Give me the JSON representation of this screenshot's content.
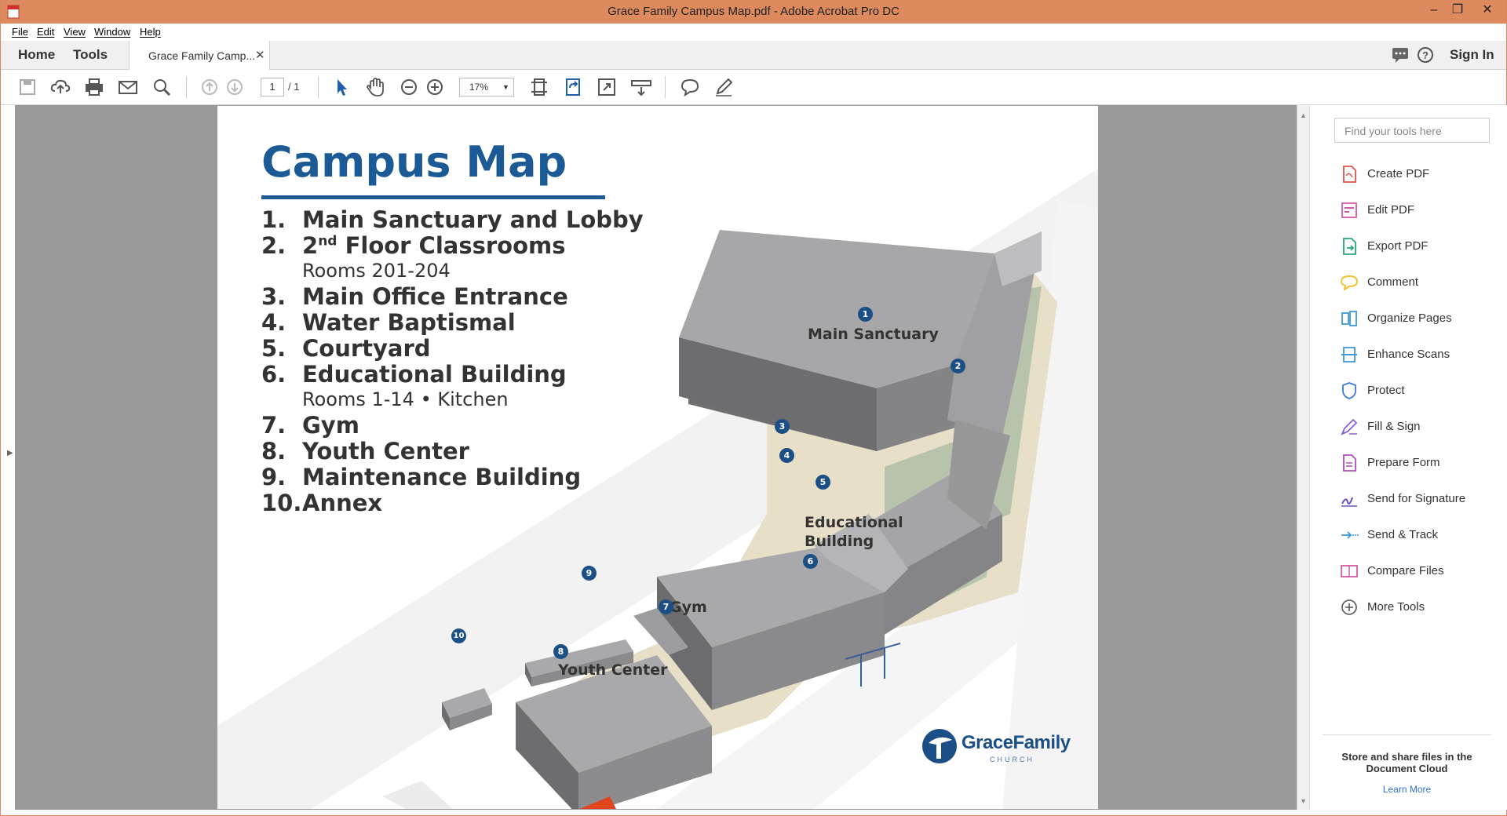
{
  "window": {
    "title": "Grace Family Campus Map.pdf - Adobe Acrobat Pro DC"
  },
  "menu": [
    "File",
    "Edit",
    "View",
    "Window",
    "Help"
  ],
  "nav": {
    "home": "Home",
    "tools": "Tools",
    "sign_in": "Sign In"
  },
  "tab": {
    "label": "Grace Family Camp..."
  },
  "toolbar": {
    "page_current": "1",
    "page_total": "/ 1",
    "zoom": "17%"
  },
  "icons": [
    "save-icon",
    "cloud-upload-icon",
    "print-icon",
    "email-icon",
    "search-icon",
    "prev-page-icon",
    "next-page-icon",
    "select-arrow-icon",
    "hand-icon",
    "zoom-out-icon",
    "zoom-in-icon",
    "page-fit-icon",
    "rotate-icon",
    "fullscreen-icon",
    "scroll-mode-icon",
    "comment-icon",
    "pen-icon",
    "chat-icon",
    "help-icon"
  ],
  "document": {
    "title": "Campus Map",
    "legend": [
      {
        "num": "1.",
        "text": "Main Sanctuary and Lobby"
      },
      {
        "num": "2.",
        "text_pre": "2",
        "text_sup": "nd",
        "text": " Floor Classrooms"
      },
      {
        "sub": "Rooms 201-204"
      },
      {
        "num": "3.",
        "text": "Main Office Entrance"
      },
      {
        "num": "4.",
        "text": "Water Baptismal"
      },
      {
        "num": "5.",
        "text": "Courtyard"
      },
      {
        "num": "6.",
        "text": "Educational Building"
      },
      {
        "sub": "Rooms 1-14 • Kitchen"
      },
      {
        "num": "7.",
        "text": "Gym"
      },
      {
        "num": "8.",
        "text": "Youth Center"
      },
      {
        "num": "9.",
        "text": "Maintenance Building"
      },
      {
        "num": "10.",
        "text": "Annex"
      }
    ],
    "map_labels": {
      "main_sanctuary": "Main Sanctuary",
      "educational_1": "Educational",
      "educational_2": "Building",
      "gym": "Gym",
      "youth_center": "Youth Center"
    },
    "badges": [
      "1",
      "2",
      "3",
      "4",
      "5",
      "6",
      "7",
      "8",
      "9",
      "10"
    ],
    "logo": {
      "name": "GraceFamily",
      "church": "CHURCH"
    }
  },
  "right_pane": {
    "search_placeholder": "Find your tools here",
    "tools": [
      {
        "label": "Create PDF",
        "color": "#e0524b",
        "icon": "create-pdf-icon"
      },
      {
        "label": "Edit PDF",
        "color": "#d659a6",
        "icon": "edit-pdf-icon"
      },
      {
        "label": "Export PDF",
        "color": "#2aa87e",
        "icon": "export-pdf-icon"
      },
      {
        "label": "Comment",
        "color": "#f0c23a",
        "icon": "comment-tool-icon"
      },
      {
        "label": "Organize Pages",
        "color": "#3c9ad6",
        "icon": "organize-pages-icon"
      },
      {
        "label": "Enhance Scans",
        "color": "#3c9ad6",
        "icon": "enhance-scans-icon"
      },
      {
        "label": "Protect",
        "color": "#3c7bd6",
        "icon": "protect-icon"
      },
      {
        "label": "Fill & Sign",
        "color": "#8c5ed6",
        "icon": "fill-sign-icon"
      },
      {
        "label": "Prepare Form",
        "color": "#b04fbf",
        "icon": "prepare-form-icon"
      },
      {
        "label": "Send for Signature",
        "color": "#6a4fbf",
        "icon": "send-signature-icon"
      },
      {
        "label": "Send & Track",
        "color": "#3c9ad6",
        "icon": "send-track-icon"
      },
      {
        "label": "Compare Files",
        "color": "#d659a6",
        "icon": "compare-files-icon"
      },
      {
        "label": "More Tools",
        "color": "#555555",
        "icon": "more-tools-icon"
      }
    ],
    "cloud_text_1": "Store and share files in the",
    "cloud_text_2": "Document Cloud",
    "learn_more": "Learn More"
  }
}
